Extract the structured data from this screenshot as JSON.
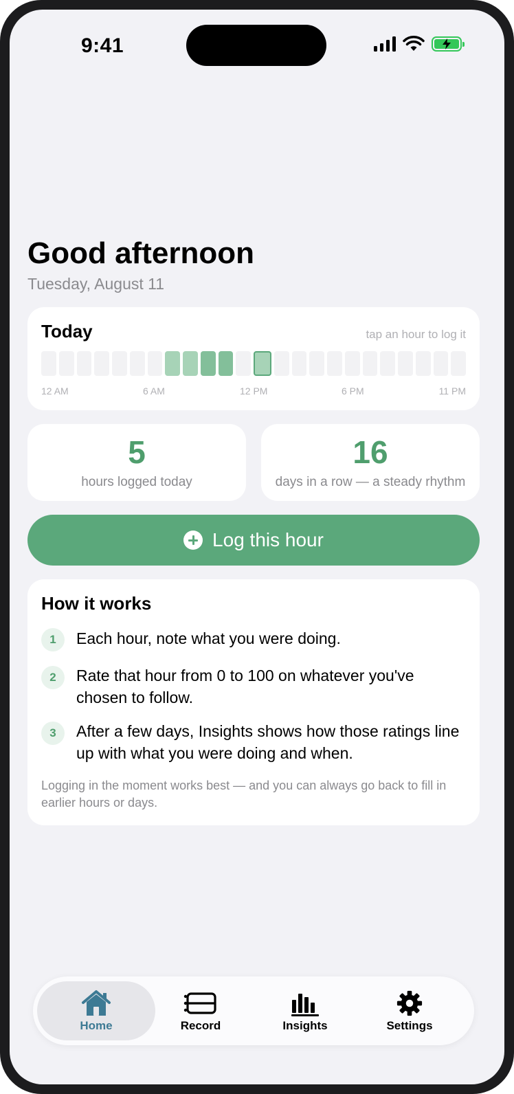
{
  "status_bar": {
    "time": "9:41"
  },
  "greeting": "Good afternoon",
  "date": "Tuesday, August 11",
  "today": {
    "title": "Today",
    "hint": "tap an hour to log it",
    "hour_axis_labels": [
      "12 AM",
      "6 AM",
      "12 PM",
      "6 PM",
      "11 PM"
    ],
    "logged_hours": [
      7,
      8,
      9,
      10,
      12
    ],
    "selected_hour": 12
  },
  "stats": {
    "hours_logged": {
      "value": "5",
      "label": "hours logged today"
    },
    "streak": {
      "value": "16",
      "label": "days in a row — a steady rhythm"
    }
  },
  "log_button": {
    "label": "Log this hour",
    "icon": "plus-circle-icon"
  },
  "how_it_works": {
    "title": "How it works",
    "steps": [
      {
        "num": "1",
        "text": "Each hour, note what you were doing."
      },
      {
        "num": "2",
        "text": "Rate that hour from 0 to 100 on whatever you've chosen to follow."
      },
      {
        "num": "3",
        "text": "After a few days, Insights shows how those ratings line up with what you were doing and when."
      }
    ],
    "note": "Logging in the moment works best — and you can always go back to fill in earlier hours or days."
  },
  "tabs": [
    {
      "label": "Home",
      "icon": "home-icon",
      "active": true
    },
    {
      "label": "Record",
      "icon": "record-icon",
      "active": false
    },
    {
      "label": "Insights",
      "icon": "insights-icon",
      "active": false
    },
    {
      "label": "Settings",
      "icon": "gear-icon",
      "active": false
    }
  ],
  "colors": {
    "accent": "#5ba87b",
    "accent_text": "#4f9e6d",
    "tab_active": "#3d7a94",
    "logged_light": "#a7d3b7",
    "logged_dark": "#83bf9a"
  }
}
